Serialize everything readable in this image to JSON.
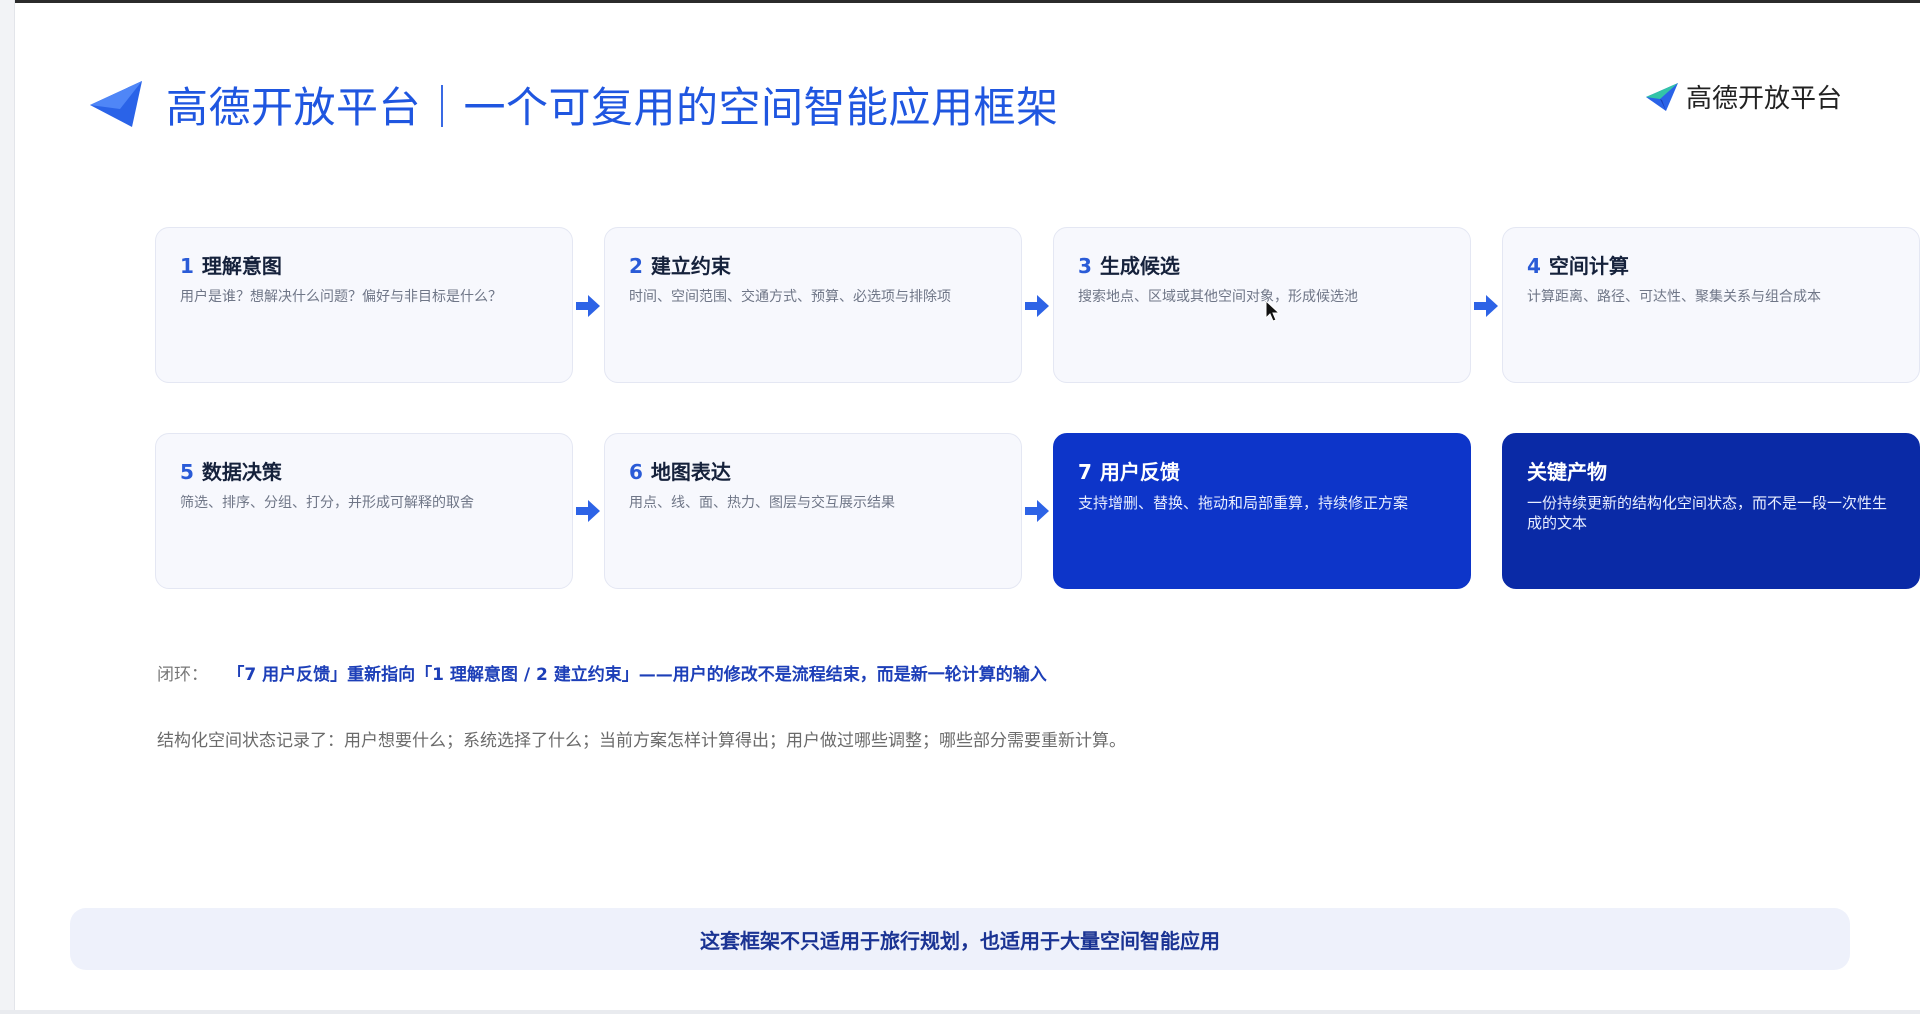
{
  "header": {
    "title": "高德开放平台｜一个可复用的空间智能应用框架",
    "title_icon": "triangle-arrow-icon",
    "logo_text": "高德开放平台",
    "logo_icon": "paper-plane-logo-icon"
  },
  "colors": {
    "accent": "#1f56e0",
    "card_bg": "#f7f8fd",
    "highlight": "#0d35c9",
    "highlight_dark": "#0a2aa6",
    "loop_text": "#1d3fb8"
  },
  "steps": [
    {
      "num": "1",
      "title": "理解意图",
      "desc": "用户是谁？想解决什么问题？偏好与非目标是什么？"
    },
    {
      "num": "2",
      "title": "建立约束",
      "desc": "时间、空间范围、交通方式、预算、必选项与排除项"
    },
    {
      "num": "3",
      "title": "生成候选",
      "desc": "搜索地点、区域或其他空间对象，形成候选池"
    },
    {
      "num": "4",
      "title": "空间计算",
      "desc": "计算距离、路径、可达性、聚集关系与组合成本"
    },
    {
      "num": "5",
      "title": "数据决策",
      "desc": "筛选、排序、分组、打分，并形成可解释的取舍"
    },
    {
      "num": "6",
      "title": "地图表达",
      "desc": "用点、线、面、热力、图层与交互展示结果"
    },
    {
      "num": "7",
      "title": "用户反馈",
      "desc": "支持增删、替换、拖动和局部重算，持续修正方案"
    }
  ],
  "output_card": {
    "title": "关键产物",
    "desc": "一份持续更新的结构化空间状态，而不是一段一次性生成的文本"
  },
  "loop": {
    "label": "闭环：",
    "text": "「7 用户反馈」重新指向「1 理解意图 / 2 建立约束」——用户的修改不是流程结束，而是新一轮计算的输入"
  },
  "note": "结构化空间状态记录了：用户想要什么；系统选择了什么；当前方案怎样计算得出；用户做过哪些调整；哪些部分需要重新计算。",
  "banner": "这套框架不只适用于旅行规划，也适用于大量空间智能应用"
}
